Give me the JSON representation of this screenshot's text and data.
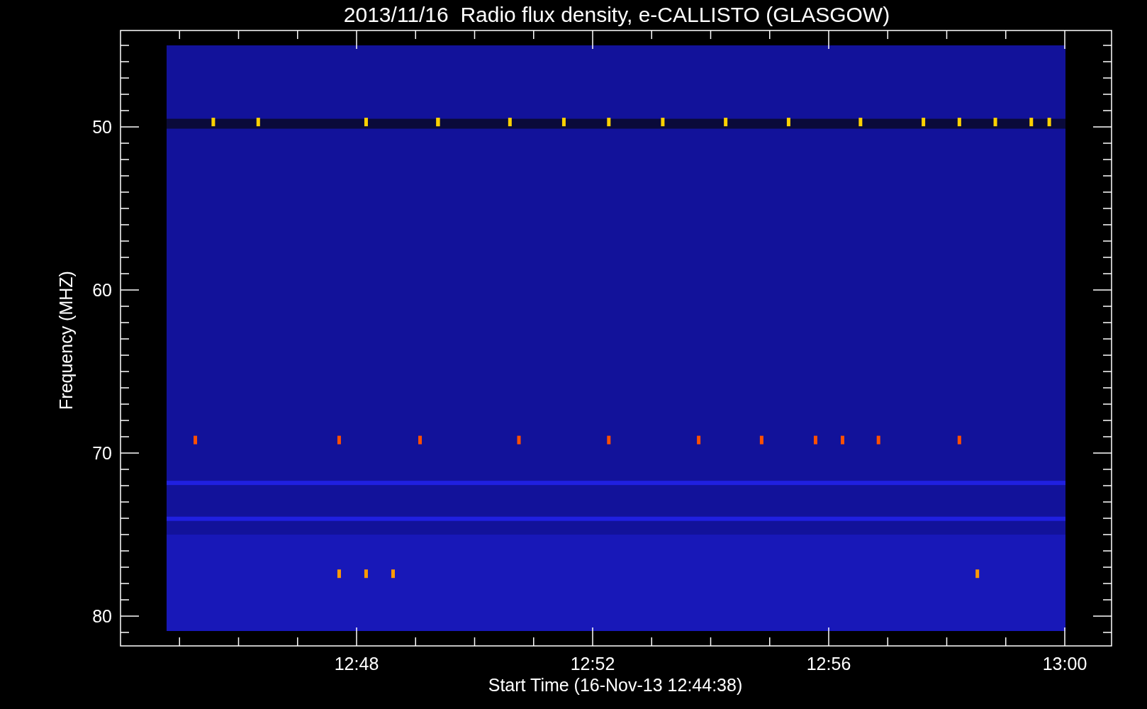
{
  "title": "2013/11/16  Radio flux density, e-CALLISTO (GLASGOW)",
  "y_axis": {
    "label": "Frequency (MHZ)",
    "ticks": [
      "50",
      "60",
      "70",
      "80"
    ]
  },
  "x_axis": {
    "label": "Start Time (16-Nov-13 12:44:38)",
    "ticks": [
      "12:48",
      "12:52",
      "12:56",
      "13:00"
    ]
  }
}
